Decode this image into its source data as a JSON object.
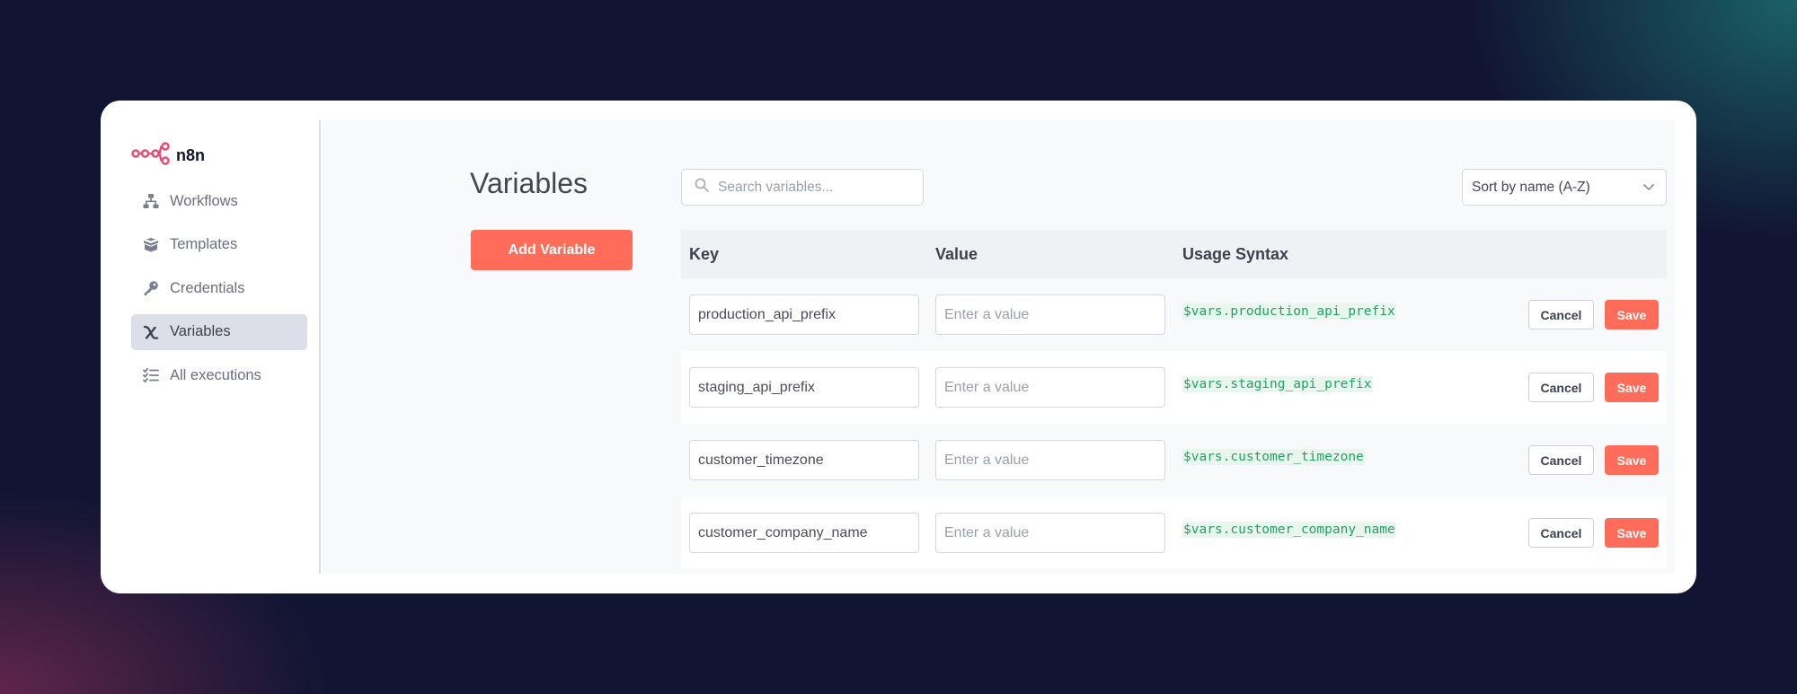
{
  "app": {
    "name": "n8n"
  },
  "sidebar": {
    "items": [
      {
        "label": "Workflows",
        "icon": "workflows-icon"
      },
      {
        "label": "Templates",
        "icon": "templates-icon"
      },
      {
        "label": "Credentials",
        "icon": "key-icon"
      },
      {
        "label": "Variables",
        "icon": "variables-icon",
        "active": true
      },
      {
        "label": "All executions",
        "icon": "executions-list-icon"
      }
    ]
  },
  "main": {
    "title": "Variables",
    "add_button_label": "Add Variable",
    "search_placeholder": "Search variables...",
    "sort_label": "Sort by name (A-Z)",
    "columns": [
      "Key",
      "Value",
      "Usage Syntax"
    ],
    "value_placeholder": "Enter a value",
    "cancel_label": "Cancel",
    "save_label": "Save",
    "rows": [
      {
        "key": "production_api_prefix",
        "usage": "$vars.production_api_prefix"
      },
      {
        "key": "staging_api_prefix",
        "usage": "$vars.staging_api_prefix"
      },
      {
        "key": "customer_timezone",
        "usage": "$vars.customer_timezone"
      },
      {
        "key": "customer_company_name",
        "usage": "$vars.customer_company_name"
      }
    ]
  },
  "colors": {
    "accent": "#ff6d5a",
    "usage_text": "#24a163",
    "background": "#111533"
  }
}
